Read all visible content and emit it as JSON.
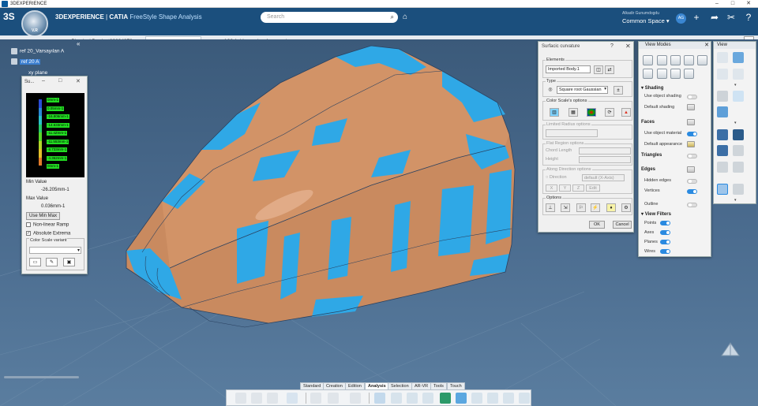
{
  "window": {
    "title": "3DEXPERIENCE"
  },
  "header": {
    "brand_strong": "3DEXPERIENCE",
    "brand_product": "CATIA",
    "brand_app": "FreeStyle Shape Analysis",
    "compass_label": "V.R",
    "search_placeholder": "Search",
    "user_name": "Alkadir Gunumdogdu",
    "space": "Common Space",
    "avatar_initials": "AG"
  },
  "tabs": [
    {
      "label": "Physical Product00004279",
      "active": false
    },
    {
      "label": "ref 20_Varsayılan A",
      "active": true
    },
    {
      "label": "ref 20.1_Varsayılan A",
      "active": false
    }
  ],
  "tree": {
    "root": "ref 20_Varsayılan A",
    "selected": "ref 20 A",
    "child": "xy plane"
  },
  "legend_panel": {
    "title": "Su...",
    "scale_values": [
      "0mm-1",
      "0.05mm-1",
      "-16.806mm-1",
      "-14.633mm-1",
      "-11.4Zmm-1",
      "-11.553mm-1",
      "-8.733mm-1",
      "-4.362mm-1",
      "0mm-1"
    ],
    "scale_colors": [
      "#2a4bd6",
      "#2a88d6",
      "#2ac0c8",
      "#29c96a",
      "#59d62a",
      "#b3d62a",
      "#e3c02a",
      "#e37b2a",
      "#d62a2a"
    ],
    "min_label": "Min Value",
    "min_value": "-26.205mm-1",
    "max_label": "Max Value",
    "max_value": "0.036mm-1",
    "use_min_max": "Use Min Max",
    "non_linear": "Non-linear Ramp",
    "non_linear_checked": false,
    "absolute_extrema": "Absolute Extrema",
    "absolute_checked": true,
    "variant_label": "Color Scale variant"
  },
  "curvature_dialog": {
    "title": "Surfacic curvature",
    "elements_label": "Elements",
    "elements_value": "Imported Body.1",
    "type_label": "Type",
    "type_value": "Square root Gaussian",
    "color_scale_label": "Color Scale's options",
    "limited_radius_label": "Limited Radius options",
    "flat_region_label": "Flat Region options",
    "chord_length_label": "Chord Length",
    "height_label": "Height",
    "along_direction_label": "Along Direction options",
    "direction_label": "Direction",
    "direction_value": "default (X-Axis)",
    "xyz": [
      "X",
      "Y",
      "Z"
    ],
    "edit_label": "Edit",
    "options_label": "Options",
    "ok_label": "OK",
    "cancel_label": "Cancel"
  },
  "view_modes": {
    "title": "View Modes",
    "shading": "Shading",
    "use_object_shading": "Use object shading",
    "use_object_shading_on": false,
    "default_shading": "Default shading",
    "faces": "Faces",
    "use_object_material": "Use object material",
    "use_object_material_on": true,
    "default_appearance": "Default appearance",
    "triangles": "Triangles",
    "triangles_on": false,
    "edges": "Edges",
    "hidden_edges": "Hidden edges",
    "hidden_edges_on": false,
    "vertices": "Vertices",
    "vertices_on": true,
    "outline": "Outline",
    "outline_on": false,
    "view_filters": "View Filters",
    "points": "Points",
    "points_on": true,
    "axes": "Axes",
    "axes_on": true,
    "planes": "Planes",
    "planes_on": true,
    "wires": "Wires",
    "wires_on": true
  },
  "view_toolbar": {
    "title": "View"
  },
  "action_bar": {
    "tabs": [
      "Standard",
      "Creation",
      "Edition",
      "Analysis",
      "Selection",
      "AR-VR",
      "Tools",
      "Touch"
    ],
    "active_tab": "Analysis"
  },
  "colors": {
    "header_bg": "#1b4f7d",
    "part_orange": "#c98a5f",
    "part_blue": "#2fa8e6",
    "accent_toggle": "#2a8ae0"
  }
}
